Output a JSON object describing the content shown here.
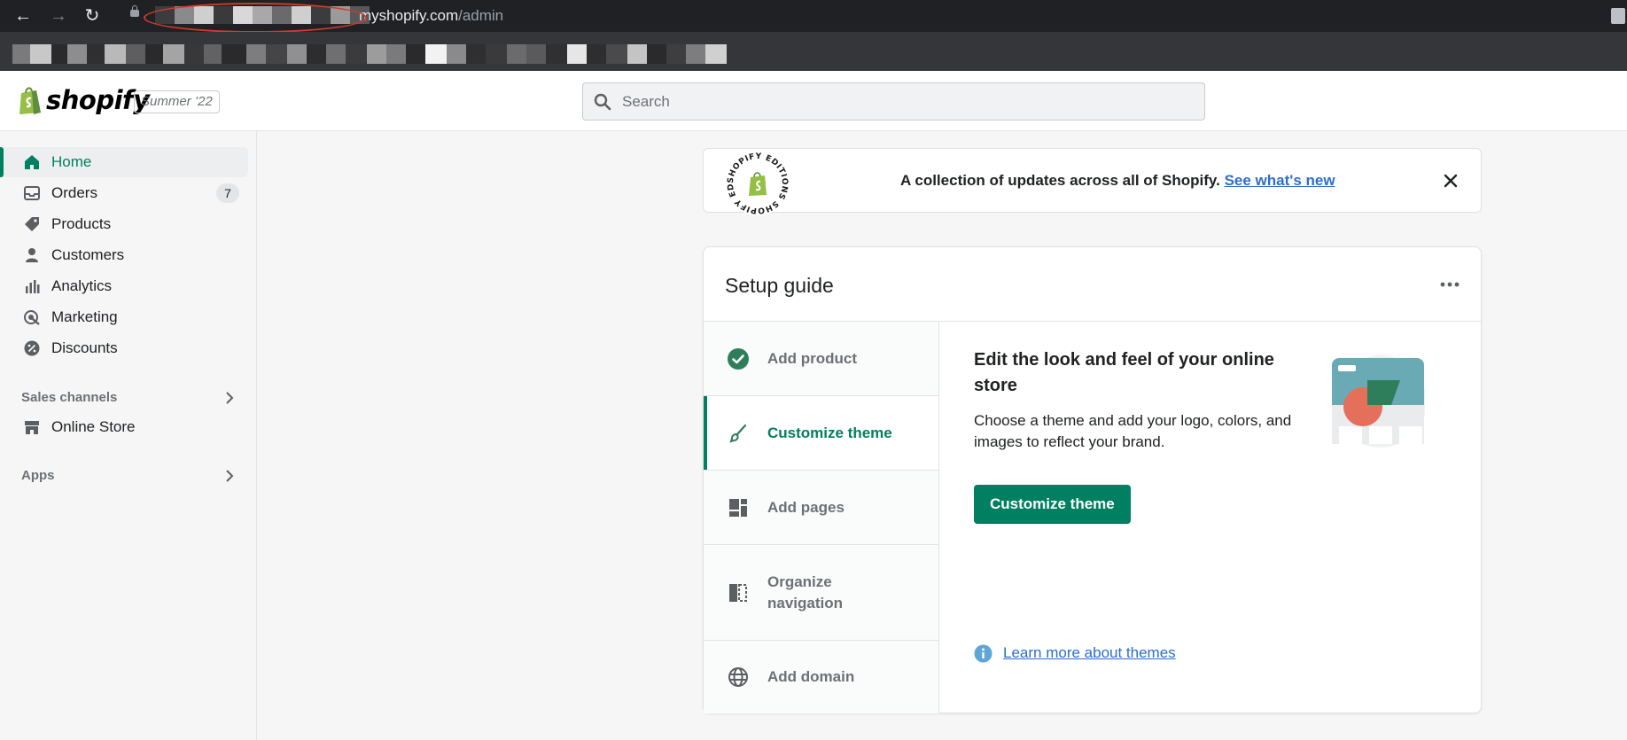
{
  "browser": {
    "back_icon": "arrow-left-icon",
    "forward_icon": "arrow-right-icon",
    "reload_icon": "reload-icon",
    "url_host": "myshopify.com",
    "url_path": "/admin"
  },
  "topbar": {
    "logo_text": "shopify",
    "edition_badge": "Summer ’22",
    "search_placeholder": "Search"
  },
  "sidebar": {
    "items": [
      {
        "label": "Home",
        "icon": "home-icon",
        "active": true
      },
      {
        "label": "Orders",
        "icon": "orders-icon",
        "badge": "7"
      },
      {
        "label": "Products",
        "icon": "tag-icon"
      },
      {
        "label": "Customers",
        "icon": "person-icon"
      },
      {
        "label": "Analytics",
        "icon": "bar-chart-icon"
      },
      {
        "label": "Marketing",
        "icon": "target-icon"
      },
      {
        "label": "Discounts",
        "icon": "discount-icon"
      }
    ],
    "sales_channels_heading": "Sales channels",
    "online_store_label": "Online Store",
    "apps_heading": "Apps"
  },
  "banner": {
    "text": "A collection of updates across all of Shopify.",
    "link": "See what's new",
    "seal_text": "SHOPIFY EDITIONS SHOPIFY EDITIONS"
  },
  "setup_guide": {
    "title": "Setup guide",
    "steps": [
      {
        "label": "Add product",
        "icon": "check-circle-icon",
        "completed": true
      },
      {
        "label": "Customize theme",
        "icon": "paintbrush-icon",
        "active": true
      },
      {
        "label": "Add pages",
        "icon": "pages-icon"
      },
      {
        "label": "Organize navigation",
        "icon": "navigation-icon"
      },
      {
        "label": "Add domain",
        "icon": "globe-icon"
      }
    ],
    "detail": {
      "title": "Edit the look and feel of your online store",
      "description": "Choose a theme and add your logo, colors, and images to reflect your brand.",
      "button": "Customize theme",
      "learn_more": "Learn more about themes"
    }
  },
  "colors": {
    "accent_green": "#008060",
    "link_blue": "#2c6ecb",
    "browser_dark": "#202124",
    "annotation_red": "#d23a2b"
  }
}
